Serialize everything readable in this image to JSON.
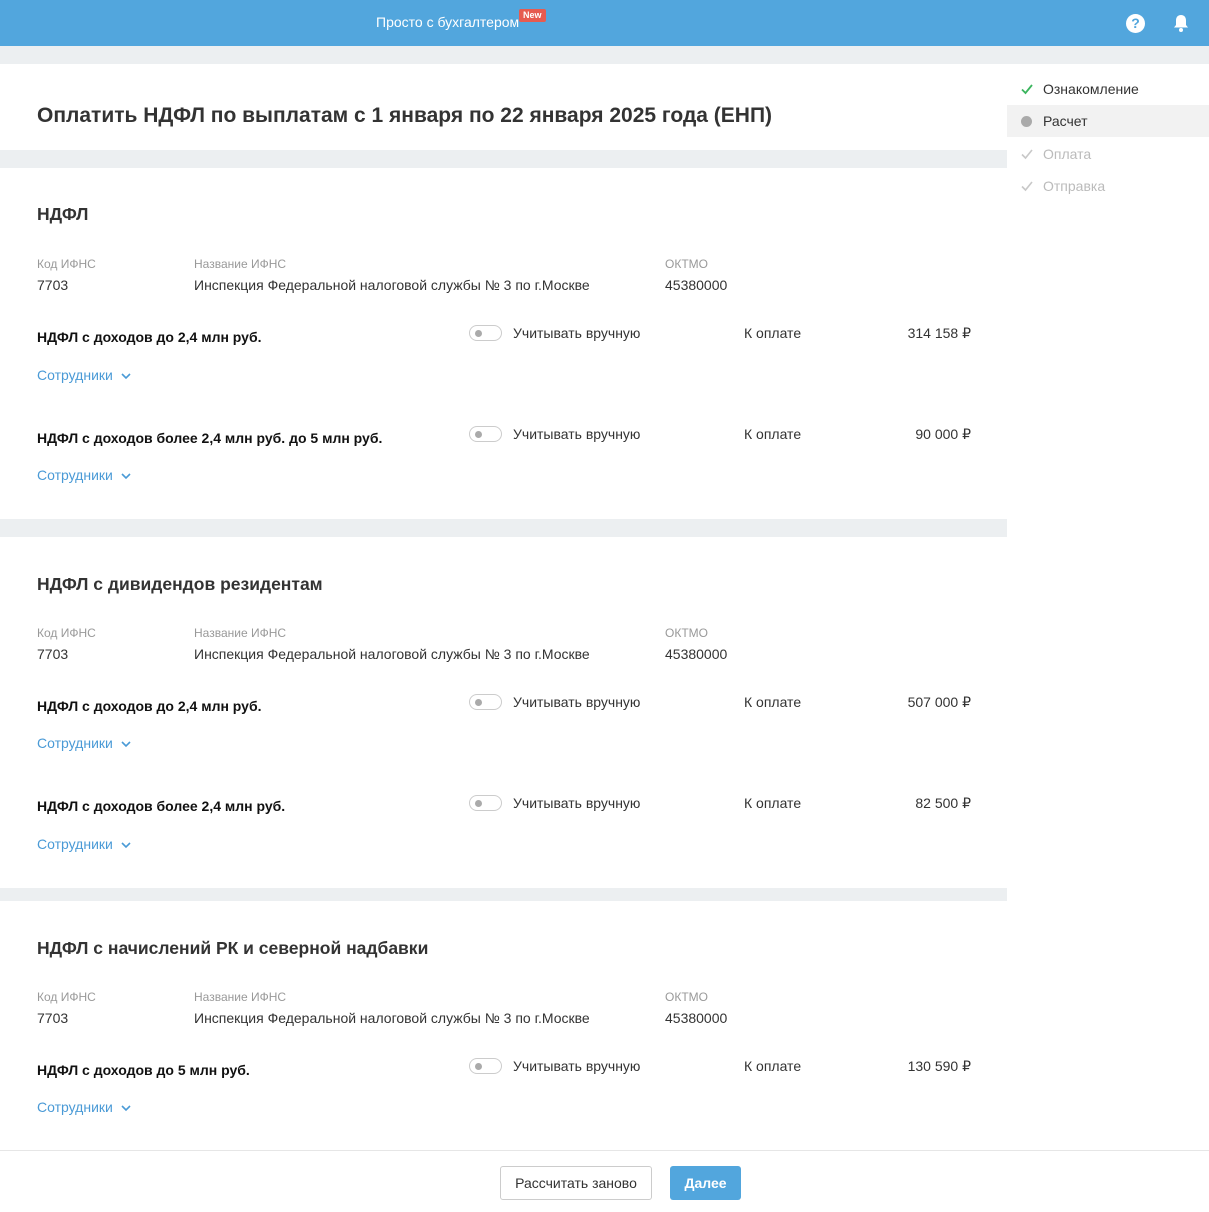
{
  "topbar": {
    "brand": "Просто с бухгалтером",
    "badge": "New",
    "help_icon": "?"
  },
  "page": {
    "title": "Оплатить НДФЛ по выплатам с 1 января по 22 января 2025 года (ЕНП)"
  },
  "labels": {
    "code_ifns": "Код ИФНС",
    "name_ifns": "Название ИФНС",
    "oktmo": "ОКТМО",
    "manual": "Учитывать вручную",
    "to_pay": "К оплате",
    "employees": "Сотрудники"
  },
  "sections": [
    {
      "title": "НДФЛ",
      "code": "7703",
      "ifns_name": "Инспекция Федеральной налоговой службы № 3 по г.Москве",
      "oktmo": "45380000",
      "rows": [
        {
          "name": "НДФЛ с доходов до 2,4 млн руб.",
          "amount": "314 158 ₽"
        },
        {
          "name": "НДФЛ с доходов более 2,4 млн руб. до 5 млн руб.",
          "amount": "90 000 ₽"
        }
      ]
    },
    {
      "title": "НДФЛ с дивидендов резидентам",
      "code": "7703",
      "ifns_name": "Инспекция Федеральной налоговой службы № 3 по г.Москве",
      "oktmo": "45380000",
      "rows": [
        {
          "name": "НДФЛ с доходов до 2,4 млн руб.",
          "amount": "507 000 ₽"
        },
        {
          "name": "НДФЛ с доходов более 2,4 млн руб.",
          "amount": "82 500 ₽"
        }
      ]
    },
    {
      "title": "НДФЛ с начислений РК и северной надбавки",
      "code": "7703",
      "ifns_name": "Инспекция Федеральной налоговой службы № 3 по г.Москве",
      "oktmo": "45380000",
      "rows": [
        {
          "name": "НДФЛ с доходов до 5 млн руб.",
          "amount": "130 590 ₽"
        }
      ]
    }
  ],
  "steps": [
    {
      "label": "Ознакомление",
      "state": "done",
      "color": "#333333"
    },
    {
      "label": "Расчет",
      "state": "current",
      "color": "#333333"
    },
    {
      "label": "Оплата",
      "state": "pending",
      "color": "#bbbbbb"
    },
    {
      "label": "Отправка",
      "state": "pending",
      "color": "#bbbbbb"
    }
  ],
  "footer": {
    "recalc": "Рассчитать заново",
    "next": "Далее"
  },
  "colors": {
    "accent": "#52a6dd",
    "link": "#4a9ad6",
    "badge": "#e65b50",
    "check_done": "#3bb55e"
  }
}
